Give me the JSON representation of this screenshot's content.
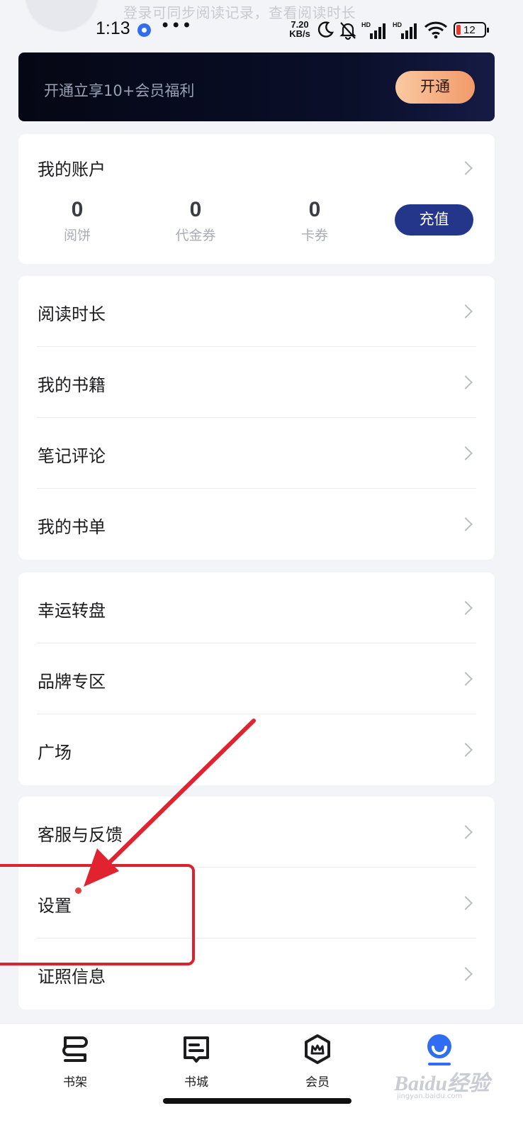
{
  "header": {
    "login_hint": "登录可同步阅读记录，查看阅读时长"
  },
  "status_bar": {
    "time": "1:13",
    "more": "•••",
    "net_speed_value": "7.20",
    "net_speed_unit": "KB/s",
    "battery": "12",
    "icons": [
      "moon-icon",
      "bell-off-icon",
      "hd-signal-icon",
      "hd-signal-icon",
      "wifi-icon",
      "battery-icon"
    ]
  },
  "vip_banner": {
    "text": "开通立享10+会员福利",
    "button": "开通"
  },
  "account": {
    "title": "我的账户",
    "stats": [
      {
        "value": "0",
        "label": "阅饼"
      },
      {
        "value": "0",
        "label": "代金券"
      },
      {
        "value": "0",
        "label": "卡券"
      }
    ],
    "recharge": "充值"
  },
  "menu_group_1": [
    {
      "label": "阅读时长"
    },
    {
      "label": "我的书籍"
    },
    {
      "label": "笔记评论"
    },
    {
      "label": "我的书单"
    }
  ],
  "menu_group_2": [
    {
      "label": "幸运转盘"
    },
    {
      "label": "品牌专区"
    },
    {
      "label": "广场"
    }
  ],
  "menu_group_3": [
    {
      "label": "客服与反馈"
    },
    {
      "label": "设置"
    },
    {
      "label": "证照信息"
    }
  ],
  "bottom_nav": [
    {
      "label": "书架",
      "icon": "bookshelf-icon"
    },
    {
      "label": "书城",
      "icon": "bookstore-icon"
    },
    {
      "label": "会员",
      "icon": "member-icon"
    },
    {
      "label": "",
      "icon": "profile-icon",
      "active": true
    }
  ],
  "watermark": {
    "logo": "Baidu经验",
    "url": "jingyan.baidu.com"
  },
  "colors": {
    "accent": "#24368a",
    "vip_button": "#f19a6a",
    "annotation": "#d9232f",
    "nav_active": "#2f6ef2"
  }
}
